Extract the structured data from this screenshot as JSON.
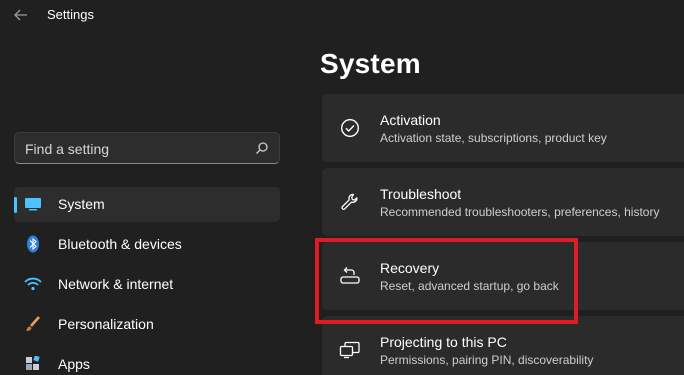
{
  "app": {
    "title": "Settings"
  },
  "search": {
    "placeholder": "Find a setting"
  },
  "sidebar": {
    "items": [
      {
        "label": "System",
        "icon": "monitor-icon",
        "selected": true
      },
      {
        "label": "Bluetooth & devices",
        "icon": "bluetooth-icon"
      },
      {
        "label": "Network & internet",
        "icon": "wifi-icon"
      },
      {
        "label": "Personalization",
        "icon": "brush-icon"
      },
      {
        "label": "Apps",
        "icon": "apps-icon"
      }
    ]
  },
  "main": {
    "title": "System",
    "cards": [
      {
        "title": "Activation",
        "description": "Activation state, subscriptions, product key",
        "icon": "check-circle-icon"
      },
      {
        "title": "Troubleshoot",
        "description": "Recommended troubleshooters, preferences, history",
        "icon": "wrench-icon"
      },
      {
        "title": "Recovery",
        "description": "Reset, advanced startup, go back",
        "icon": "recovery-icon",
        "highlighted": true
      },
      {
        "title": "Projecting to this PC",
        "description": "Permissions, pairing PIN, discoverability",
        "icon": "projecting-icon"
      }
    ]
  },
  "colors": {
    "background": "#202020",
    "card": "#2b2b2b",
    "accent": "#4cc2ff",
    "highlight_border": "#e01b24"
  }
}
